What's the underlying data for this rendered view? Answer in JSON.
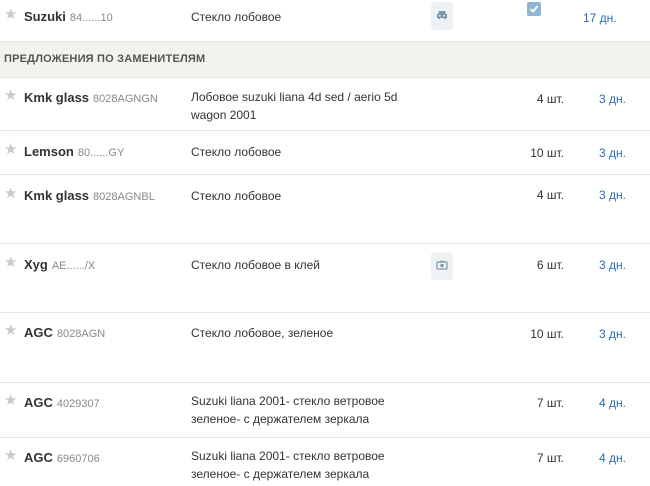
{
  "top_row": {
    "brand": "Suzuki",
    "code": "84......10",
    "description": "Стекло лобовое",
    "icon": "car-icon",
    "checked": true,
    "days": "17 дн."
  },
  "section": {
    "title": "ПРЕДЛОЖЕНИЯ ПО ЗАМЕНИТЕЛЯМ"
  },
  "rows": [
    {
      "brand": "Kmk glass",
      "code": "8028AGNGN",
      "description": "Лобовое suzuki liana 4d sed / aerio 5d wagon 2001",
      "qty": "4 шт.",
      "days": "3 дн."
    },
    {
      "brand": "Lemson",
      "code": "80......GY",
      "description": "Стекло лобовое",
      "qty": "10 шт.",
      "days": "3 дн."
    },
    {
      "brand": "Kmk glass",
      "code": "8028AGNBL",
      "description": "Стекло лобовое",
      "qty": "4 шт.",
      "days": "3 дн."
    },
    {
      "brand": "Xyg",
      "code": "AE....../X",
      "description": "Стекло лобовое в клей",
      "icon": "camera-icon",
      "qty": "6 шт.",
      "days": "3 дн."
    },
    {
      "brand": "AGC",
      "code": "8028AGN",
      "description": "Стекло лобовое, зеленое",
      "qty": "10 шт.",
      "days": "3 дн."
    },
    {
      "brand": "AGC",
      "code": "4029307",
      "description": "Suzuki liana 2001- стекло ветровое зеленое- с держателем зеркала",
      "qty": "7 шт.",
      "days": "4 дн."
    },
    {
      "brand": "AGC",
      "code": "6960706",
      "description": "Suzuki liana 2001- стекло ветровое зеленое- с держателем зеркала",
      "qty": "7 шт.",
      "days": "4 дн."
    }
  ]
}
